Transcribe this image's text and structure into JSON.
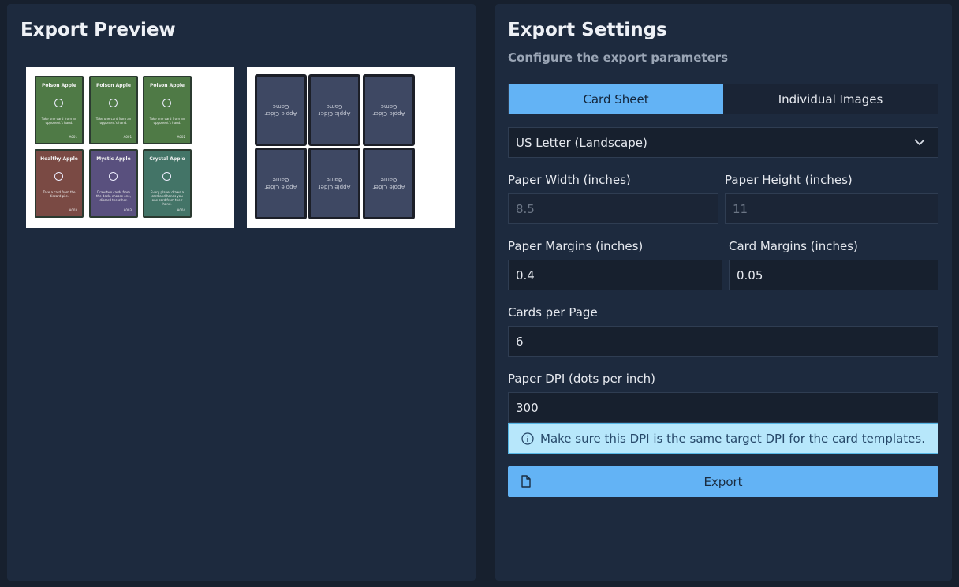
{
  "preview": {
    "title": "Export Preview",
    "front_cards": [
      {
        "name": "Poison Apple",
        "text": "Take one card from an opponent's hand.",
        "id": "A001",
        "color": "#4f7a46"
      },
      {
        "name": "Poison Apple",
        "text": "Take one card from an opponent's hand.",
        "id": "A001",
        "color": "#4f7a46"
      },
      {
        "name": "Poison Apple",
        "text": "Take one card from an opponent's hand.",
        "id": "A002",
        "color": "#4f7a46"
      },
      {
        "name": "Healthy Apple",
        "text": "Take a card from the discard pile.",
        "id": "A003",
        "color": "#7a4a44"
      },
      {
        "name": "Mystic Apple",
        "text": "Draw two cards from the deck, choose one, discard the other.",
        "id": "A003",
        "color": "#59507e"
      },
      {
        "name": "Crystal Apple",
        "text": "Every player draws a card and hands you one card from their hand.",
        "id": "A004",
        "color": "#437467"
      }
    ],
    "back_text": "Apple Cider Game"
  },
  "settings": {
    "title": "Export Settings",
    "subtitle": "Configure the export parameters",
    "tabs": [
      "Card Sheet",
      "Individual Images"
    ],
    "paper_size": "US Letter (Landscape)",
    "paper_width_label": "Paper Width (inches)",
    "paper_width": "8.5",
    "paper_height_label": "Paper Height (inches)",
    "paper_height": "11",
    "paper_margins_label": "Paper Margins (inches)",
    "paper_margins": "0.4",
    "card_margins_label": "Card Margins (inches)",
    "card_margins": "0.05",
    "cards_per_page_label": "Cards per Page",
    "cards_per_page": "6",
    "dpi_label": "Paper DPI (dots per inch)",
    "dpi": "300",
    "dpi_info": "Make sure this DPI is the same target DPI for the card templates.",
    "export_label": "Export"
  }
}
